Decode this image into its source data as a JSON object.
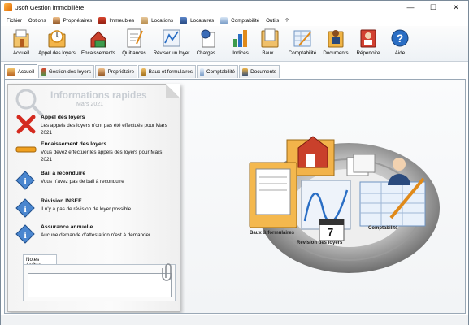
{
  "window": {
    "title": "Jsoft Gestion immobilière",
    "minimize": "—",
    "maximize": "☐",
    "close": "✕"
  },
  "menu": [
    {
      "label": "Fichier",
      "icon": ""
    },
    {
      "label": "Options",
      "icon": ""
    },
    {
      "label": "Propriétaires",
      "icon": "owner-icon"
    },
    {
      "label": "Immeubles",
      "icon": "building-icon"
    },
    {
      "label": "Locations",
      "icon": "rental-icon"
    },
    {
      "label": "Locataires",
      "icon": "tenant-icon"
    },
    {
      "label": "Comptabilité",
      "icon": "accounting-icon"
    },
    {
      "label": "Outils",
      "icon": ""
    },
    {
      "label": "?",
      "icon": ""
    }
  ],
  "toolbar": [
    {
      "label": "Accueil",
      "icon": "home-icon"
    },
    {
      "label": "Appel des loyers",
      "icon": "clock-folder-icon"
    },
    {
      "label": "Encaissements",
      "icon": "cash-icon"
    },
    {
      "label": "Quittances",
      "icon": "receipt-icon"
    },
    {
      "label": "Réviser un loyer",
      "icon": "chart-icon"
    },
    {
      "label": "Charges...",
      "icon": "charges-icon"
    },
    {
      "label": "Indices",
      "icon": "indices-icon"
    },
    {
      "label": "Baux...",
      "icon": "lease-icon"
    },
    {
      "label": "Comptabilité",
      "icon": "accounting-icon"
    },
    {
      "label": "Documents",
      "icon": "documents-icon"
    },
    {
      "label": "Répertoire",
      "icon": "directory-icon"
    },
    {
      "label": "Aide",
      "icon": "help-icon"
    }
  ],
  "tabs": [
    {
      "label": "Accueil",
      "active": true
    },
    {
      "label": "Gestion des loyers",
      "active": false
    },
    {
      "label": "Propriétaire",
      "active": false
    },
    {
      "label": "Baux et formulaires",
      "active": false
    },
    {
      "label": "Comptabilité",
      "active": false
    },
    {
      "label": "Documents",
      "active": false
    }
  ],
  "quick_info": {
    "title": "Informations rapides",
    "month": "Mars 2021",
    "items": [
      {
        "title": "Appel des loyers",
        "desc": "Les appels des loyers n'ont pas été effectués pour Mars 2021",
        "icon": "red-x-icon"
      },
      {
        "title": "Encaissement des loyers",
        "desc": "Vous devez effectuer les appels des loyers pour Mars 2021",
        "icon": "orange-bar-icon"
      },
      {
        "title": "Bail à reconduire",
        "desc": "Vous n'avez pas de bail à reconduire",
        "icon": "info-icon"
      },
      {
        "title": "Révision INSEE",
        "desc": "Il n'y a pas de révision de loyer possible",
        "icon": "info-icon"
      },
      {
        "title": "Assurance annuelle",
        "desc": "Aucune demande d'attestation n'est à demander",
        "icon": "info-icon"
      }
    ],
    "notes_label": "Notes écrites",
    "notes_value": ""
  },
  "hub": {
    "labels": [
      "Baux & formulaires",
      "Révision des loyers",
      "Comptabilité"
    ],
    "calendar_day": "7"
  },
  "colors": {
    "accent": "#2a6ec4",
    "toolbar_bg": "#eef2f6",
    "panel_title": "#c8cdd3",
    "border": "#9aa8b6"
  }
}
